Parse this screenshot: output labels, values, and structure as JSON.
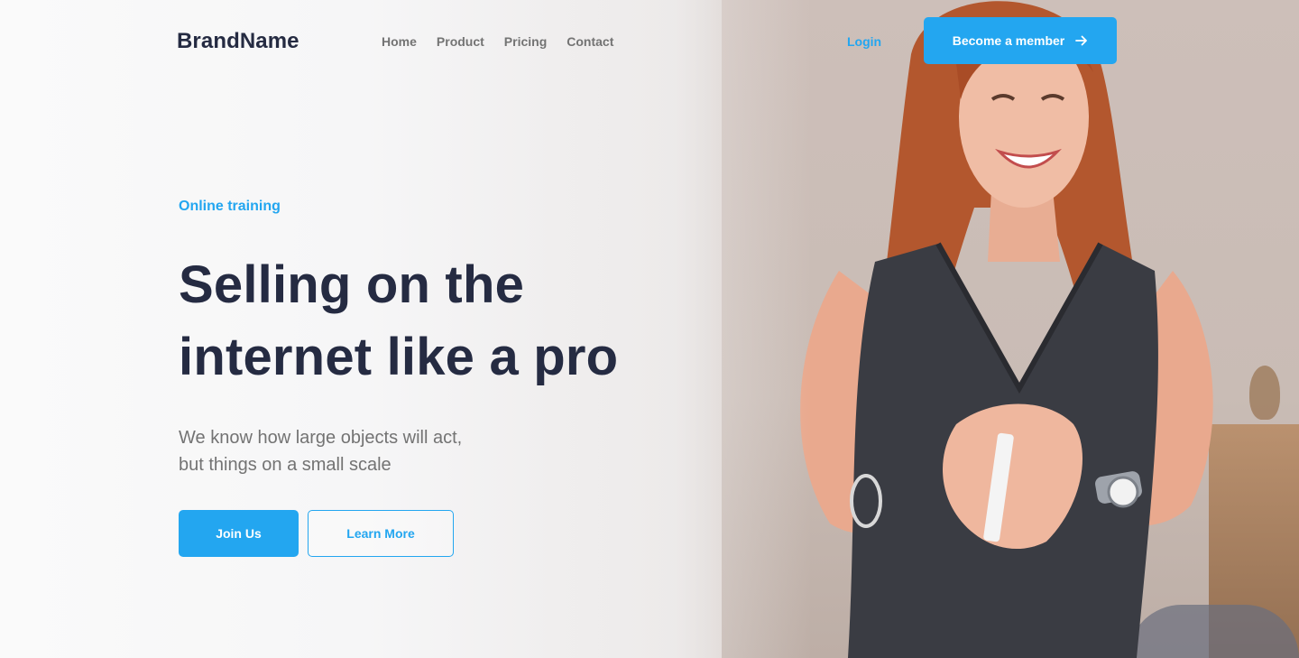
{
  "header": {
    "brand": "BrandName",
    "nav": [
      "Home",
      "Product",
      "Pricing",
      "Contact"
    ],
    "login_label": "Login",
    "member_button_label": "Become a member"
  },
  "hero": {
    "eyebrow": "Online training",
    "title_line1": "Selling on the",
    "title_line2": "internet like a pro",
    "subtitle_line1": "We know how large objects will act,",
    "subtitle_line2": "but things on a small scale",
    "primary_button_label": "Join Us",
    "secondary_button_label": "Learn More"
  },
  "colors": {
    "accent": "#23A6F0",
    "heading": "#252B42",
    "body": "#737373"
  },
  "icons": {
    "member_button_icon": "arrow-right-icon"
  }
}
